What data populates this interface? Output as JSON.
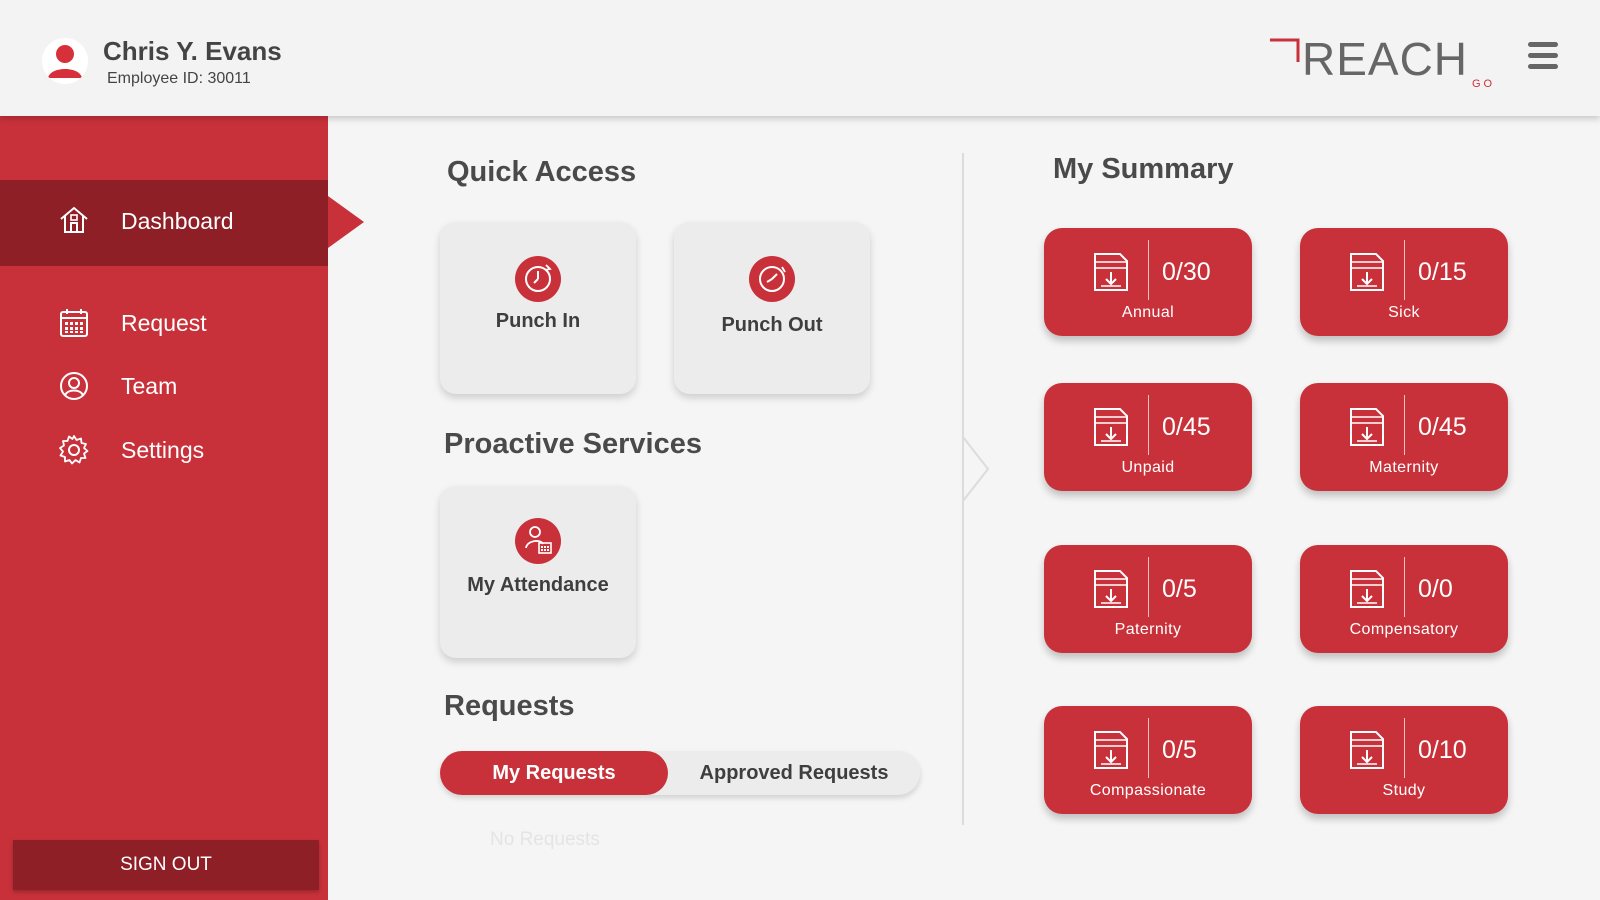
{
  "header": {
    "user_name": "Chris Y. Evans",
    "employee_id": "Employee ID: 30011",
    "logo_text": "REACH",
    "logo_sub": "GO"
  },
  "sidebar": {
    "items": [
      {
        "label": "Dashboard",
        "icon": "home-icon",
        "active": true
      },
      {
        "label": "Request",
        "icon": "calendar-icon",
        "active": false
      },
      {
        "label": "Team",
        "icon": "user-circle-icon",
        "active": false
      },
      {
        "label": "Settings",
        "icon": "gear-icon",
        "active": false
      }
    ],
    "sign_out": "SIGN OUT"
  },
  "quick_access": {
    "title": "Quick Access",
    "tiles": [
      {
        "label": "Punch In",
        "icon": "clock-in-icon"
      },
      {
        "label": "Punch Out",
        "icon": "clock-out-icon"
      }
    ]
  },
  "proactive": {
    "title": "Proactive Services",
    "tiles": [
      {
        "label": "My Attendance",
        "icon": "attendance-icon"
      }
    ]
  },
  "requests": {
    "title": "Requests",
    "tabs": [
      {
        "label": "My Requests",
        "active": true
      },
      {
        "label": "Approved Requests",
        "active": false
      }
    ],
    "empty_text": "No Requests"
  },
  "summary": {
    "title": "My Summary",
    "cards": [
      {
        "value": "0/30",
        "label": "Annual"
      },
      {
        "value": "0/15",
        "label": "Sick"
      },
      {
        "value": "0/45",
        "label": "Unpaid"
      },
      {
        "value": "0/45",
        "label": "Maternity"
      },
      {
        "value": "0/5",
        "label": "Paternity"
      },
      {
        "value": "0/0",
        "label": "Compensatory"
      },
      {
        "value": "0/5",
        "label": "Compassionate"
      },
      {
        "value": "0/10",
        "label": "Study"
      }
    ]
  },
  "colors": {
    "accent": "#c9313a",
    "accent_dark": "#8e1f26",
    "background": "#f5f5f5",
    "tile": "#ececec"
  }
}
